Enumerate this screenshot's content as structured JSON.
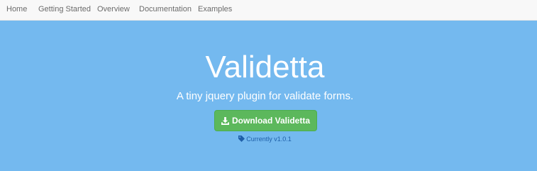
{
  "navbar": {
    "items": [
      {
        "label": "Home"
      },
      {
        "label": "Getting Started"
      },
      {
        "label": "Overview"
      },
      {
        "label": "Documentation"
      },
      {
        "label": "Examples"
      }
    ]
  },
  "hero": {
    "title": "Validetta",
    "subtitle": "A tiny jquery plugin for validate forms.",
    "download_label": "Download Validetta",
    "download_icon": "download-icon",
    "version_text": "Currently v1.0.1",
    "version_icon": "tag-icon"
  },
  "colors": {
    "navbar_bg": "#f8f8f8",
    "hero_bg": "#74b9ef",
    "button_bg": "#5cb85c",
    "version_text": "#1f5fa8"
  }
}
